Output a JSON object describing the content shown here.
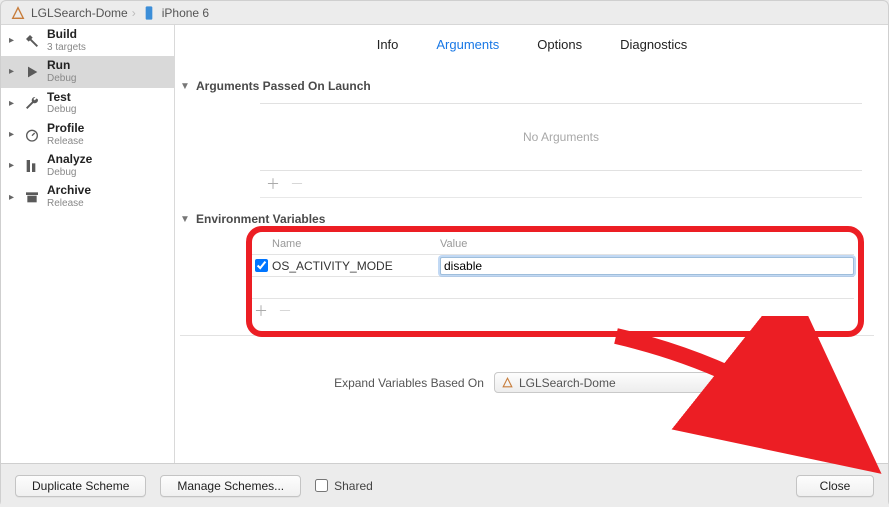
{
  "crumbs": {
    "project": "LGLSearch-Dome",
    "device": "iPhone 6"
  },
  "sidebar": {
    "items": [
      {
        "title": "Build",
        "sub": "3 targets"
      },
      {
        "title": "Run",
        "sub": "Debug"
      },
      {
        "title": "Test",
        "sub": "Debug"
      },
      {
        "title": "Profile",
        "sub": "Release"
      },
      {
        "title": "Analyze",
        "sub": "Debug"
      },
      {
        "title": "Archive",
        "sub": "Release"
      }
    ]
  },
  "tabs": {
    "info": "Info",
    "arguments": "Arguments",
    "options": "Options",
    "diagnostics": "Diagnostics"
  },
  "sections": {
    "argsTitle": "Arguments Passed On Launch",
    "noArgs": "No Arguments",
    "envTitle": "Environment Variables",
    "envHead": {
      "name": "Name",
      "value": "Value"
    },
    "envRow": {
      "name": "OS_ACTIVITY_MODE",
      "value": "disable"
    }
  },
  "expand": {
    "label": "Expand Variables Based On",
    "selected": "LGLSearch-Dome"
  },
  "footer": {
    "dup": "Duplicate Scheme",
    "manage": "Manage Schemes...",
    "shared": "Shared",
    "close": "Close"
  }
}
